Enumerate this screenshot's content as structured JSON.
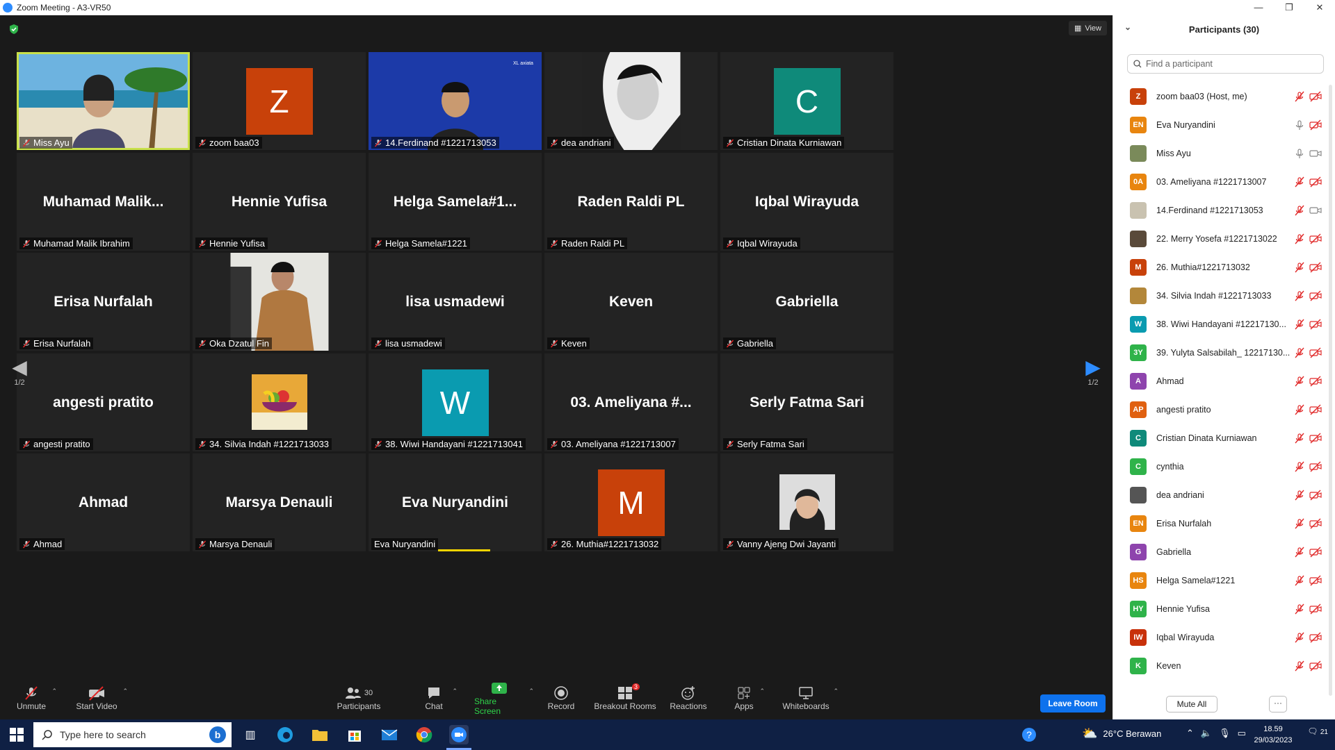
{
  "window": {
    "title": "Zoom Meeting - A3-VR50",
    "minimize": "—",
    "maximize": "❐",
    "close": "✕"
  },
  "view_button": "View",
  "pager": {
    "left": "1/2",
    "right": "1/2"
  },
  "tiles": [
    {
      "label": "Miss Ayu",
      "big": "",
      "type": "video-ayu"
    },
    {
      "label": "zoom baa03",
      "big": "",
      "type": "letter",
      "letter": "Z",
      "color": "#c8410a"
    },
    {
      "label": "14.Ferdinand #1221713053",
      "big": "",
      "type": "video-ferdinand"
    },
    {
      "label": "dea andriani",
      "big": "",
      "type": "photo-dea"
    },
    {
      "label": "Cristian Dinata Kurniawan",
      "big": "",
      "type": "letter",
      "letter": "C",
      "color": "#0f8a7a"
    },
    {
      "label": "Muhamad Malik Ibrahim",
      "big": "Muhamad  Malik...",
      "type": "name"
    },
    {
      "label": "Hennie Yufisa",
      "big": "Hennie Yufisa",
      "type": "name"
    },
    {
      "label": "Helga Samela#1221",
      "big": "Helga  Samela#1...",
      "type": "name"
    },
    {
      "label": "Raden Raldi PL",
      "big": "Raden Raldi PL",
      "type": "name"
    },
    {
      "label": "Iqbal Wirayuda",
      "big": "Iqbal Wirayuda",
      "type": "name"
    },
    {
      "label": "Erisa Nurfalah",
      "big": "Erisa Nurfalah",
      "type": "name"
    },
    {
      "label": "Oka Dzatul Fin",
      "big": "",
      "type": "photo-oka"
    },
    {
      "label": "lisa usmadewi",
      "big": "lisa usmadewi",
      "type": "name"
    },
    {
      "label": "Keven",
      "big": "Keven",
      "type": "name"
    },
    {
      "label": "Gabriella",
      "big": "Gabriella",
      "type": "name"
    },
    {
      "label": "angesti pratito",
      "big": "angesti pratito",
      "type": "name"
    },
    {
      "label": "34. Silvia Indah #1221713033",
      "big": "",
      "type": "photo-fruit"
    },
    {
      "label": "38. Wiwi Handayani #1221713041",
      "big": "",
      "type": "letter",
      "letter": "W",
      "color": "#0a9bb0"
    },
    {
      "label": "03. Ameliyana #1221713007",
      "big": "03.  Ameliyana #...",
      "type": "name"
    },
    {
      "label": "Serly Fatma Sari",
      "big": "Serly Fatma Sari",
      "type": "name"
    },
    {
      "label": "Ahmad",
      "big": "Ahmad",
      "type": "name"
    },
    {
      "label": "Marsya Denauli",
      "big": "Marsya Denauli",
      "type": "name"
    },
    {
      "label": "Eva Nuryandini",
      "big": "Eva Nuryandini",
      "type": "name-speaking"
    },
    {
      "label": "26. Muthia#1221713032",
      "big": "",
      "type": "letter",
      "letter": "M",
      "color": "#c8410a"
    },
    {
      "label": "Vanny Ajeng Dwi Jayanti",
      "big": "",
      "type": "photo-vanny"
    }
  ],
  "toolbar": {
    "unmute": "Unmute",
    "start_video": "Start Video",
    "participants": "Participants",
    "participants_count": "30",
    "chat": "Chat",
    "share_screen": "Share Screen",
    "record": "Record",
    "breakout_rooms": "Breakout Rooms",
    "breakout_badge": "3",
    "reactions": "Reactions",
    "apps": "Apps",
    "whiteboards": "Whiteboards",
    "leave_room": "Leave Room"
  },
  "panel": {
    "title": "Participants (30)",
    "search_placeholder": "Find a participant",
    "mute_all": "Mute All",
    "more": "···",
    "participants": [
      {
        "name": "zoom baa03 (Host, me)",
        "initials": "Z",
        "color": "#c8410a",
        "mic": "muted",
        "cam": "off"
      },
      {
        "name": "Eva Nuryandini",
        "initials": "EN",
        "color": "#e8850f",
        "mic": "on",
        "cam": "off"
      },
      {
        "name": "Miss Ayu",
        "initials": "",
        "color": "#7a8a5a",
        "mic": "on",
        "cam": "on"
      },
      {
        "name": "03. Ameliyana #1221713007",
        "initials": "0A",
        "color": "#e8850f",
        "mic": "muted",
        "cam": "off"
      },
      {
        "name": "14.Ferdinand #1221713053",
        "initials": "",
        "color": "#c9c2b0",
        "mic": "muted",
        "cam": "on"
      },
      {
        "name": "22. Merry Yosefa #1221713022",
        "initials": "",
        "color": "#5a4a3a",
        "mic": "muted",
        "cam": "off"
      },
      {
        "name": "26. Muthia#1221713032",
        "initials": "M",
        "color": "#c8410a",
        "mic": "muted",
        "cam": "off"
      },
      {
        "name": "34. Silvia Indah #1221713033",
        "initials": "",
        "color": "#b3873a",
        "mic": "muted",
        "cam": "off"
      },
      {
        "name": "38. Wiwi Handayani #12217130...",
        "initials": "W",
        "color": "#0a9bb0",
        "mic": "muted",
        "cam": "off"
      },
      {
        "name": "39. Yulyta Salsabilah_ 12217130...",
        "initials": "3Y",
        "color": "#2fb34a",
        "mic": "muted",
        "cam": "off"
      },
      {
        "name": "Ahmad",
        "initials": "A",
        "color": "#8e44ad",
        "mic": "muted",
        "cam": "off"
      },
      {
        "name": "angesti pratito",
        "initials": "AP",
        "color": "#e06010",
        "mic": "muted",
        "cam": "off"
      },
      {
        "name": "Cristian Dinata Kurniawan",
        "initials": "C",
        "color": "#0f8a7a",
        "mic": "muted",
        "cam": "off"
      },
      {
        "name": "cynthia",
        "initials": "C",
        "color": "#2fb34a",
        "mic": "muted",
        "cam": "off"
      },
      {
        "name": "dea andriani",
        "initials": "",
        "color": "#555555",
        "mic": "muted",
        "cam": "off"
      },
      {
        "name": "Erisa Nurfalah",
        "initials": "EN",
        "color": "#e8850f",
        "mic": "muted",
        "cam": "off"
      },
      {
        "name": "Gabriella",
        "initials": "G",
        "color": "#8e44ad",
        "mic": "muted",
        "cam": "off"
      },
      {
        "name": "Helga Samela#1221",
        "initials": "HS",
        "color": "#e8850f",
        "mic": "muted",
        "cam": "off"
      },
      {
        "name": "Hennie Yufisa",
        "initials": "HY",
        "color": "#2fb34a",
        "mic": "muted",
        "cam": "off"
      },
      {
        "name": "Iqbal Wirayuda",
        "initials": "IW",
        "color": "#c8310a",
        "mic": "muted",
        "cam": "off"
      },
      {
        "name": "Keven",
        "initials": "K",
        "color": "#2fb34a",
        "mic": "muted",
        "cam": "off"
      }
    ]
  },
  "taskbar": {
    "search_placeholder": "Type here to search",
    "weather": "26°C Berawan",
    "time": "18.59",
    "date": "29/03/2023",
    "notifications": "21"
  },
  "colors": {
    "accent": "#0e72ed",
    "active_speaker": "#c8e04a",
    "muted_red": "#e02828"
  }
}
